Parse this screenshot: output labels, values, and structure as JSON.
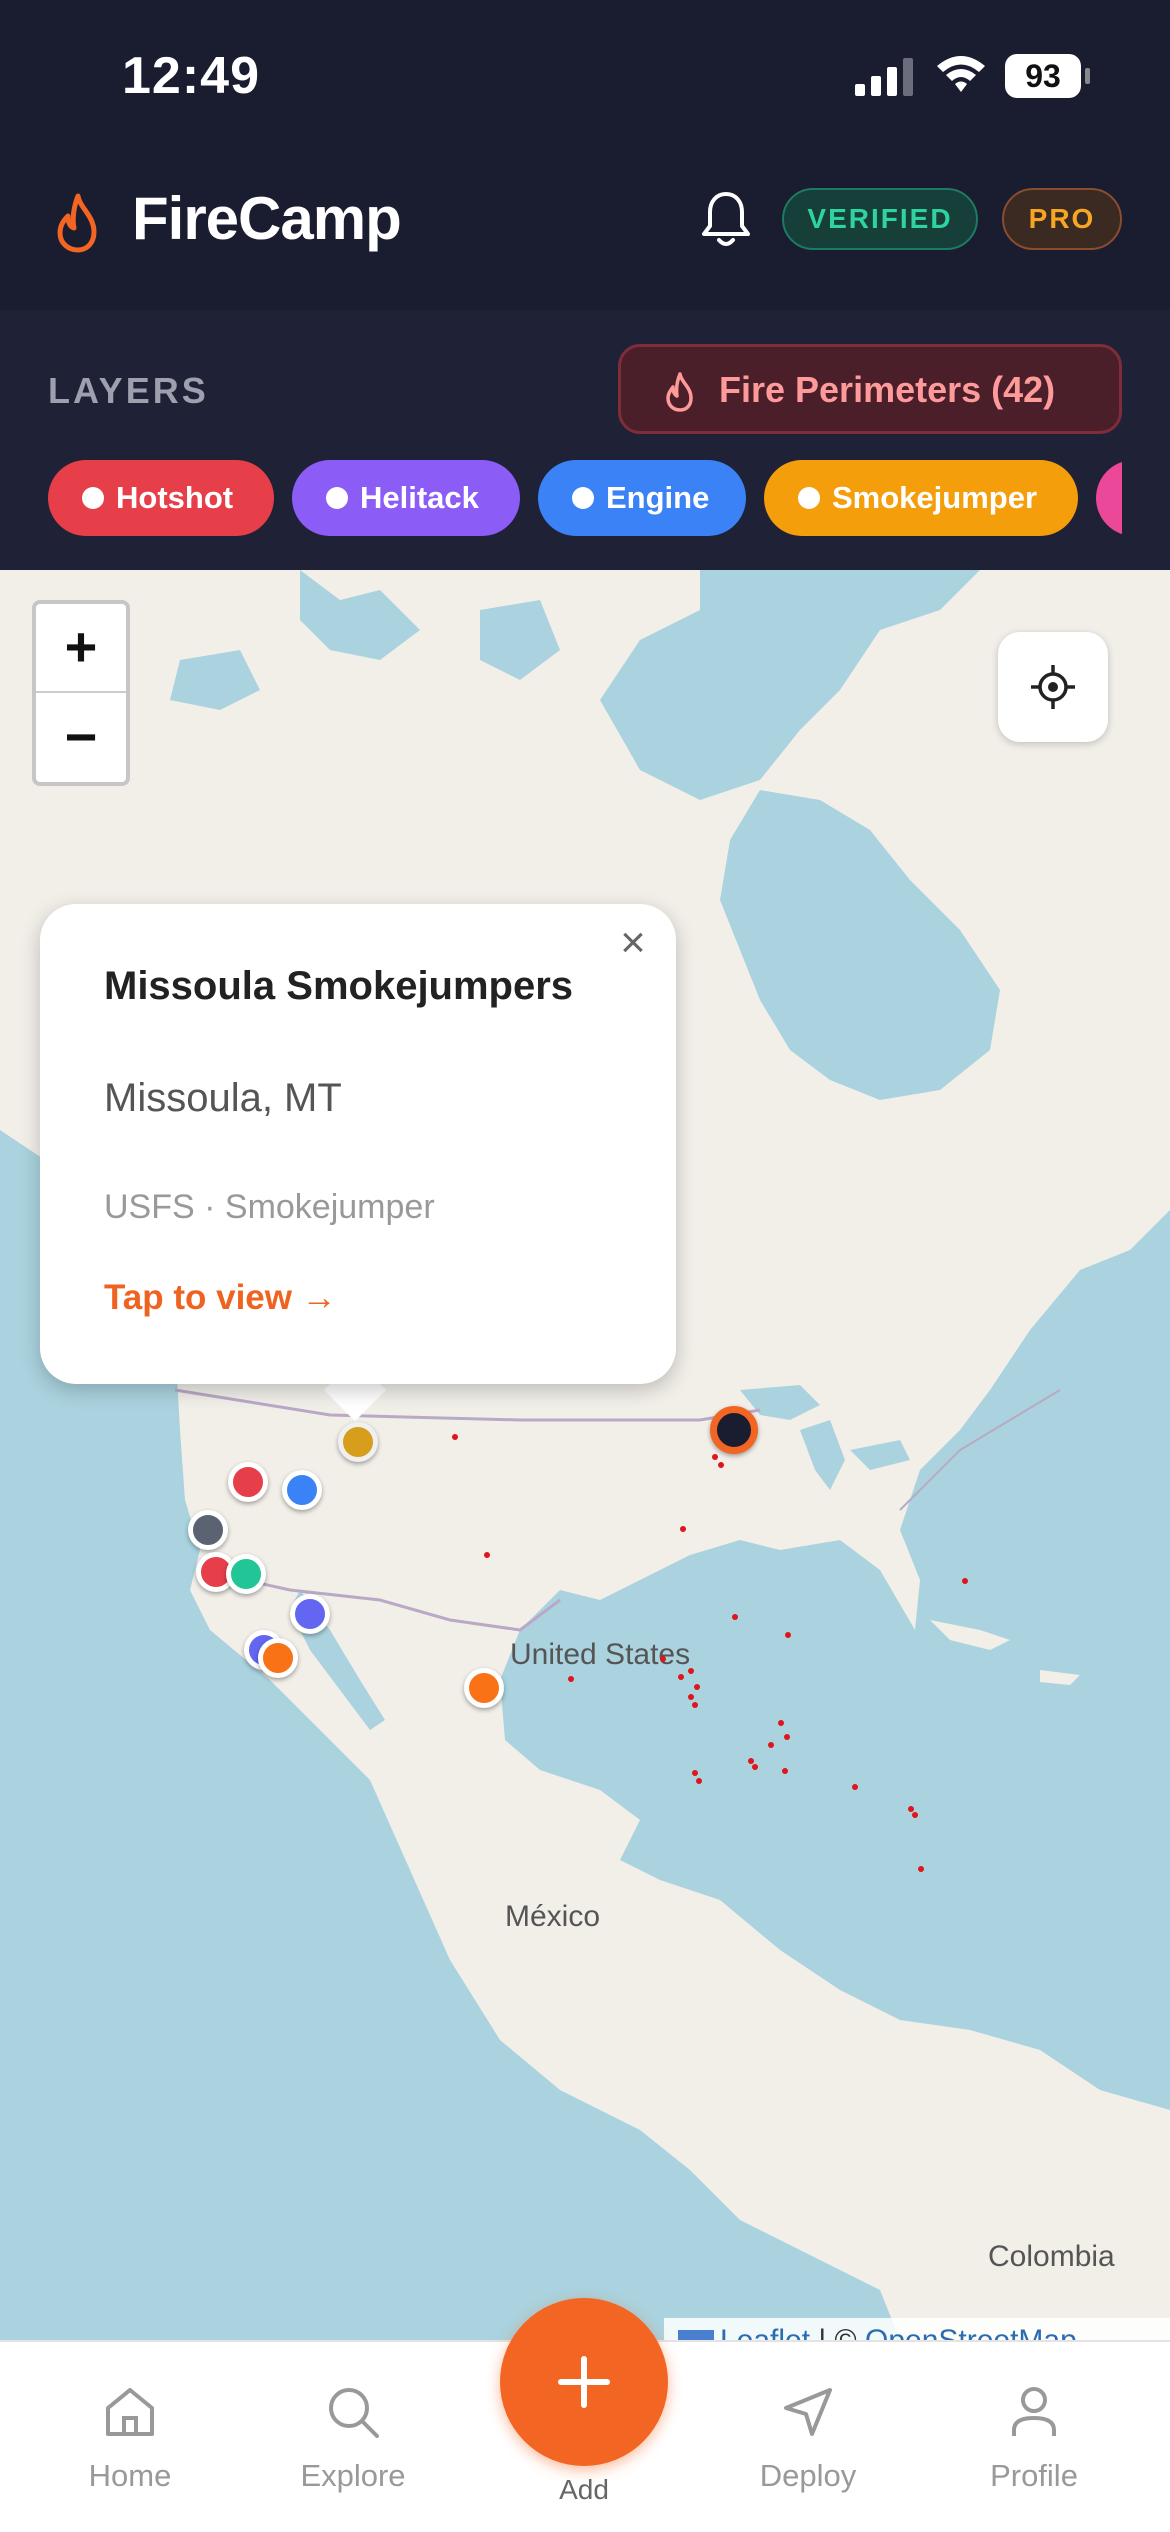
{
  "status_bar": {
    "time": "12:49",
    "battery": "93"
  },
  "header": {
    "app_name": "FireCamp",
    "badge_verified": "VERIFIED",
    "badge_pro": "PRO"
  },
  "layers": {
    "label": "LAYERS",
    "perimeters_button": "Fire Perimeters (42)",
    "chips": [
      {
        "label": "Hotshot",
        "color": "#e63f4a"
      },
      {
        "label": "Helitack",
        "color": "#8b5cf6"
      },
      {
        "label": "Engine",
        "color": "#3b82f6"
      },
      {
        "label": "Smokejumper",
        "color": "#f59e0b"
      },
      {
        "label": "",
        "color": "#ec4899"
      }
    ]
  },
  "map": {
    "zoom_in": "+",
    "zoom_out": "−",
    "labels": {
      "us": "United States",
      "mexico": "México",
      "colombia": "Colombia"
    },
    "attribution": {
      "leaflet": "Leaflet",
      "separator": " | © ",
      "osm": "OpenStreetMap"
    },
    "popup": {
      "title": "Missoula Smokejumpers",
      "location": "Missoula, MT",
      "meta": "USFS · Smokejumper",
      "link": "Tap to view →",
      "close": "×"
    }
  },
  "tabbar": {
    "home": "Home",
    "explore": "Explore",
    "add": "Add",
    "deploy": "Deploy",
    "profile": "Profile"
  },
  "colors": {
    "accent": "#f26522",
    "header_bg": "#1a1c30"
  }
}
